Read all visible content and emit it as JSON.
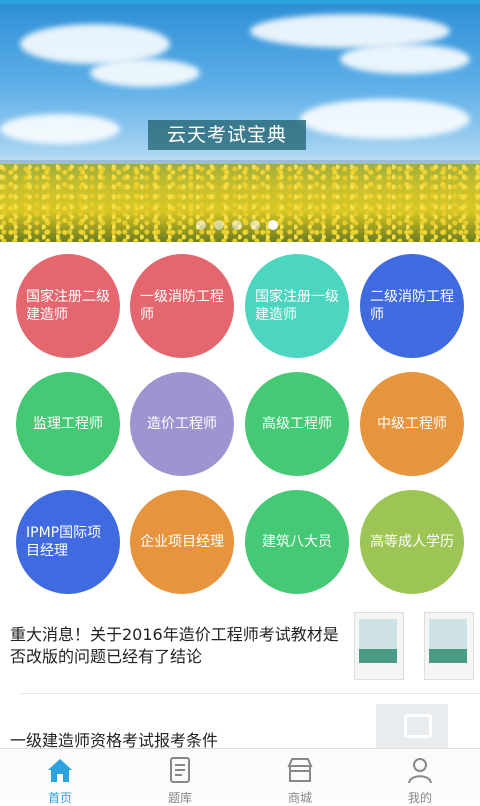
{
  "banner": {
    "title": "云天考试宝典",
    "slide_count": 5,
    "active_slide": 5
  },
  "categories": [
    {
      "label": "国家注册二级建造师",
      "color": "#e4676f"
    },
    {
      "label": "一级消防工程师",
      "color": "#e4676f"
    },
    {
      "label": "国家注册一级建造师",
      "color": "#4dd6bf"
    },
    {
      "label": "二级消防工程师",
      "color": "#3f6ae0"
    },
    {
      "label": "监理工程师",
      "color": "#45c975"
    },
    {
      "label": "造价工程师",
      "color": "#9d95cf"
    },
    {
      "label": "高级工程师",
      "color": "#45c975"
    },
    {
      "label": "中级工程师",
      "color": "#e7943f"
    },
    {
      "label": "IPMP国际项目经理",
      "color": "#3f6ae0"
    },
    {
      "label": "企业项目经理",
      "color": "#e7943f"
    },
    {
      "label": "建筑八大员",
      "color": "#45c975"
    },
    {
      "label": "高等成人学历",
      "color": "#9cc556"
    }
  ],
  "news": [
    {
      "title": "重大消息！关于2016年造价工程师考试教材是否改版的问题已经有了结论"
    },
    {
      "title": "一级建造师资格考试报考条件"
    }
  ],
  "nav": [
    {
      "label": "首页",
      "icon": "home-icon",
      "active": true
    },
    {
      "label": "题库",
      "icon": "document-icon",
      "active": false
    },
    {
      "label": "商城",
      "icon": "store-icon",
      "active": false
    },
    {
      "label": "我的",
      "icon": "user-icon",
      "active": false
    }
  ],
  "colors": {
    "accent": "#2aa3df",
    "nav_inactive": "#888888"
  }
}
